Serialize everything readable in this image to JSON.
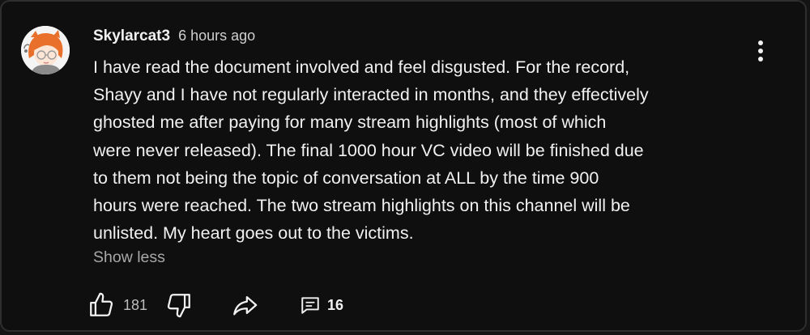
{
  "comment": {
    "author": "Skylarcat3",
    "timestamp": "6 hours ago",
    "lines": [
      "I have read the document involved and feel disgusted. For the record,",
      "Shayy and I have not regularly interacted in months, and they effectively",
      "ghosted me after paying for many stream highlights (most of which",
      "were never released). The final 1000 hour VC video will be finished due",
      "to them not being the topic of conversation at ALL by the time 900",
      "hours were reached. The two stream highlights on this channel will be",
      "unlisted. My heart goes out to the victims."
    ],
    "show_less_label": "Show less"
  },
  "actions": {
    "like_count": "181",
    "reply_count": "16"
  },
  "icons": {
    "menu": "more-vertical-icon",
    "like": "thumbs-up-icon",
    "dislike": "thumbs-down-icon",
    "share": "share-arrow-icon",
    "replies": "comment-bubble-icon"
  },
  "colors": {
    "background": "#0f0f0f",
    "text": "#f1f1f1",
    "muted": "#a8a8a8",
    "avatar_hair": "#e8702a"
  }
}
